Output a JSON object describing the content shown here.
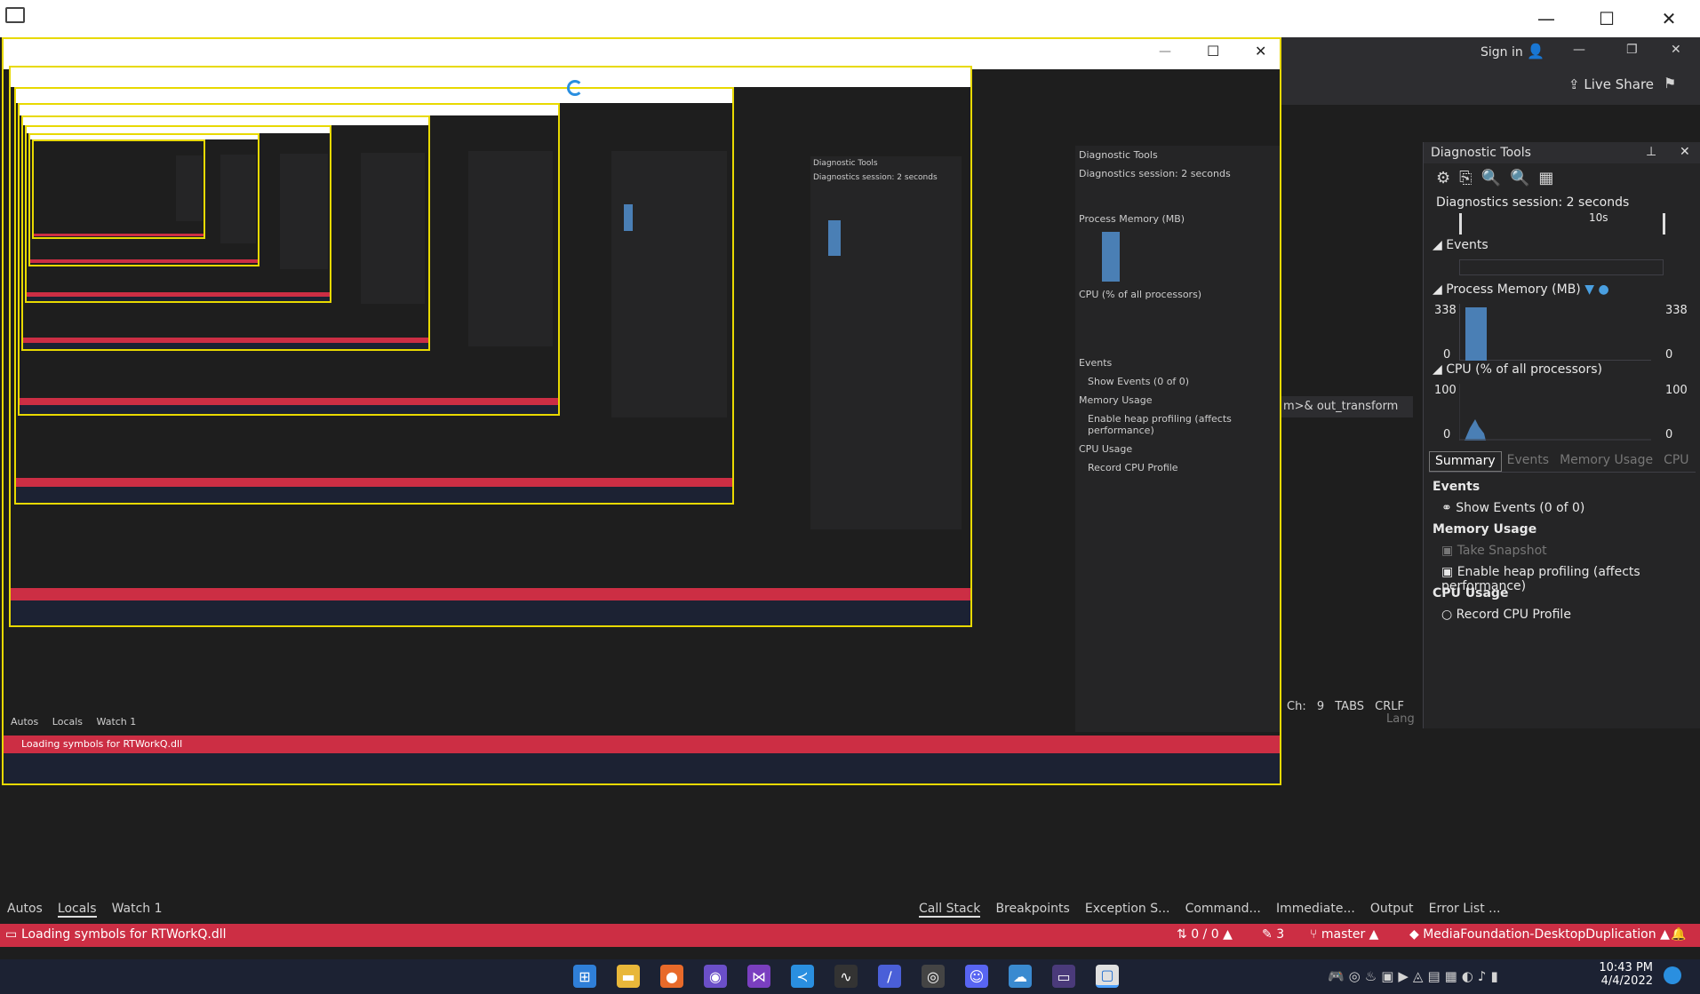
{
  "window": {
    "minimize": "—",
    "maximize": "☐",
    "close": "✕"
  },
  "topbar": {
    "sign_in": "Sign in",
    "live_share": "Live Share"
  },
  "diagnostics": {
    "panel_title": "Diagnostic Tools",
    "session": "Diagnostics session: 2 seconds",
    "timeline_label": "10s",
    "events_header": "Events",
    "process_memory_header": "Process Memory (MB)",
    "mem_max_left": "338",
    "mem_max_right": "338",
    "mem_min_left": "0",
    "mem_min_right": "0",
    "cpu_header": "CPU (% of all processors)",
    "cpu_max_left": "100",
    "cpu_max_right": "100",
    "cpu_min_left": "0",
    "cpu_min_right": "0",
    "tabs": [
      "Summary",
      "Events",
      "Memory Usage",
      "CPU"
    ],
    "summary_events_title": "Events",
    "show_events": "Show Events (0 of 0)",
    "memory_usage_title": "Memory Usage",
    "take_snapshot": "Take Snapshot",
    "enable_heap": "Enable heap profiling (affects performance)",
    "cpu_usage_title": "CPU Usage",
    "record_cpu": "Record CPU Profile"
  },
  "editor": {
    "code_fragment": "m>& out_transform",
    "ch": "Ch: 9",
    "tabs_label": "TABS",
    "crlf": "CRLF",
    "lang": "Lang"
  },
  "bottom_left_tabs": [
    "Autos",
    "Locals",
    "Watch 1"
  ],
  "bottom_right_tabs": [
    "Call Stack",
    "Breakpoints",
    "Exception S...",
    "Command...",
    "Immediate...",
    "Output",
    "Error List ..."
  ],
  "statusbar": {
    "message": "Loading symbols for RTWorkQ.dll",
    "errors": "0 / 0",
    "edits": "3",
    "branch": "master",
    "repo": "MediaFoundation-DesktopDuplication"
  },
  "taskbar": {
    "time": "10:43 PM",
    "date": "4/4/2022",
    "apps": [
      "windows-start",
      "file-explorer",
      "firefox",
      "github-desktop",
      "visual-studio",
      "vs-code",
      "perf-monitor",
      "visual-studio-preview",
      "obs",
      "discord",
      "chat",
      "terminal",
      "capture-app"
    ]
  },
  "colors": {
    "status_red": "#cc2e44",
    "selection_yellow": "#e8d900",
    "chart_fill": "#4a7fb5",
    "panel_bg": "#1e1e1e"
  }
}
